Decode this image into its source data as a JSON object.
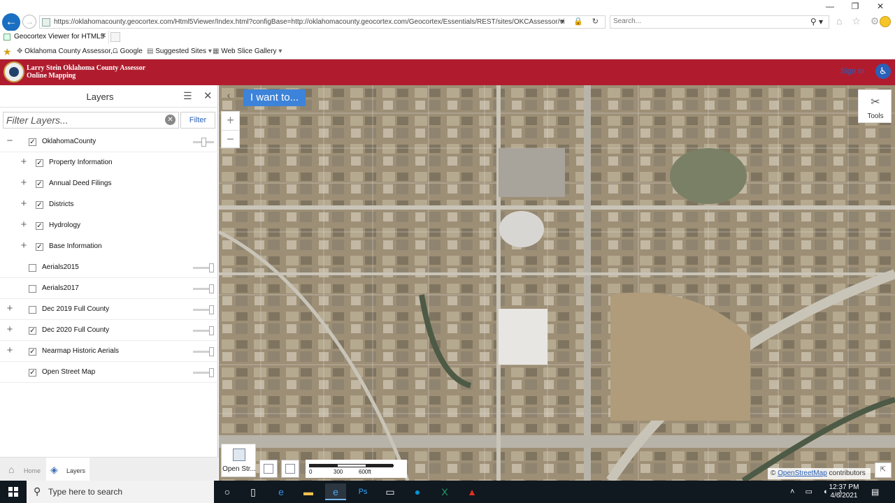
{
  "browser": {
    "url": "https://oklahomacounty.geocortex.com/Html5Viewer/Index.html?configBase=http://oklahomacounty.geocortex.com/Geocortex/Essentials/REST/sites/OKCAssessor/viewers/OKCAs",
    "search_placeholder": "Search...",
    "tab_title": "Geocortex Viewer for HTML5",
    "favorites": [
      {
        "label": "Oklahoma County Assessor,..."
      },
      {
        "label": "Google"
      },
      {
        "label": "Suggested Sites"
      },
      {
        "label": "Web Slice Gallery"
      }
    ]
  },
  "header": {
    "title_line1": "Larry Stein Oklahoma County Assessor",
    "title_line2": "Online Mapping",
    "sign_in": "Sign In"
  },
  "layers_panel": {
    "title": "Layers",
    "filter_placeholder": "Filter Layers...",
    "filter_button": "Filter",
    "layers": [
      {
        "label": "OklahomaCounty",
        "checked": true,
        "level": 0,
        "expander": "−",
        "bold": true,
        "slider": 0.5
      },
      {
        "label": "Property Information",
        "checked": true,
        "level": 1,
        "expander": "+"
      },
      {
        "label": "Annual Deed Filings",
        "checked": true,
        "level": 1,
        "expander": "+"
      },
      {
        "label": "Districts",
        "checked": true,
        "level": 1,
        "expander": "+"
      },
      {
        "label": "Hydrology",
        "checked": true,
        "level": 1,
        "expander": "+"
      },
      {
        "label": "Base Information",
        "checked": true,
        "level": 1,
        "expander": "+"
      },
      {
        "label": "Aerials2015",
        "checked": false,
        "level": 0,
        "expander": "",
        "bold": true,
        "slider": 1.0
      },
      {
        "label": "Aerials2017",
        "checked": false,
        "level": 0,
        "expander": "",
        "bold": true,
        "slider": 1.0
      },
      {
        "label": "Dec 2019 Full County",
        "checked": false,
        "level": 0,
        "expander": "+",
        "bold": true,
        "slider": 1.0
      },
      {
        "label": "Dec 2020 Full County",
        "checked": true,
        "level": 0,
        "expander": "+",
        "bold": true,
        "slider": 1.0
      },
      {
        "label": "Nearmap Historic Aerials",
        "checked": true,
        "level": 0,
        "expander": "+",
        "bold": true,
        "slider": 1.0
      },
      {
        "label": "Open Street Map",
        "checked": true,
        "level": 0,
        "expander": "",
        "bold": true,
        "slider": 1.0
      }
    ],
    "footer_tabs": [
      {
        "label": "Home",
        "icon": "home-icon",
        "active": false
      },
      {
        "label": "Layers",
        "icon": "layers-icon",
        "active": true
      }
    ]
  },
  "map": {
    "i_want_to": "I want to...",
    "zoom_in": "+",
    "zoom_out": "−",
    "tools_label": "Tools",
    "basemap_label": "Open Str...",
    "scale_labels": [
      "0",
      "300",
      "600ft"
    ],
    "attribution_prefix": "©",
    "attribution_link": "OpenStreetMap",
    "attribution_suffix": "contributors"
  },
  "taskbar": {
    "search_text": "Type here to search",
    "time": "12:37 PM",
    "date": "4/6/2021",
    "apps": [
      "task-view-icon",
      "edge-icon",
      "file-explorer-icon",
      "ie-icon",
      "photoshop-icon",
      "remote-desktop-icon",
      "hp-icon",
      "excel-icon",
      "acrobat-icon"
    ]
  },
  "colors": {
    "header_red": "#b01c2e",
    "accent_blue": "#3c83d9",
    "taskbar": "#101820"
  }
}
